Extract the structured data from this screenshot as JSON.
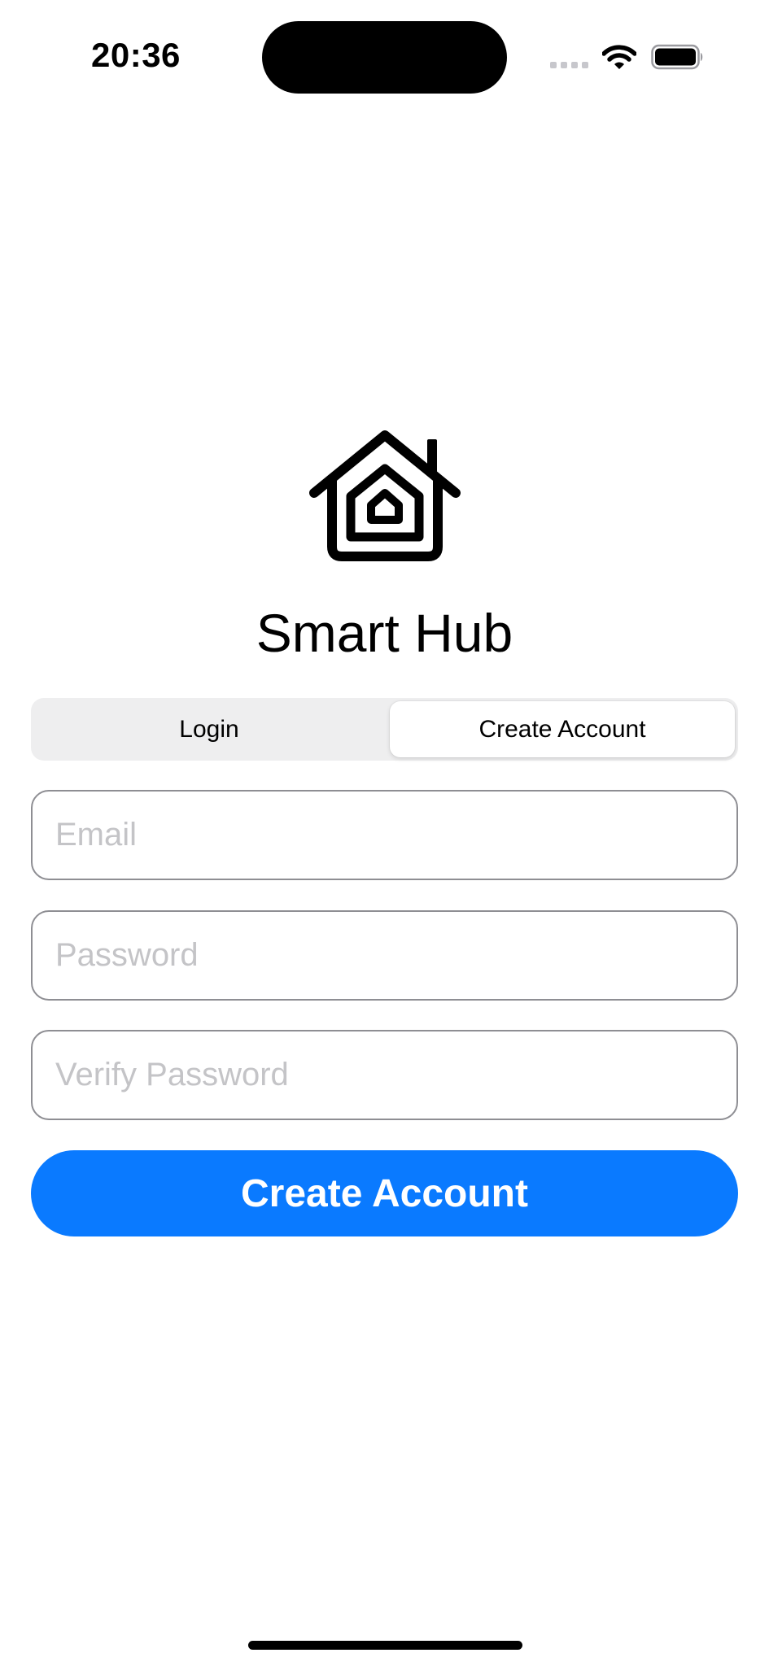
{
  "status_bar": {
    "time": "20:36",
    "icons": [
      "cellular-signal-icon",
      "wifi-icon",
      "battery-icon"
    ]
  },
  "app": {
    "logo_icon": "home-icon",
    "title": "Smart Hub"
  },
  "auth_mode": {
    "options": [
      "Login",
      "Create Account"
    ],
    "selected": "Create Account"
  },
  "form": {
    "email_placeholder": "Email",
    "email_value": "",
    "password_placeholder": "Password",
    "password_value": "",
    "verify_placeholder": "Verify Password",
    "verify_value": "",
    "submit_label": "Create Account"
  },
  "colors": {
    "accent": "#0a7aff",
    "segment_background": "#eeeeef",
    "field_border": "#8e8e93",
    "placeholder": "#c4c4c7"
  }
}
